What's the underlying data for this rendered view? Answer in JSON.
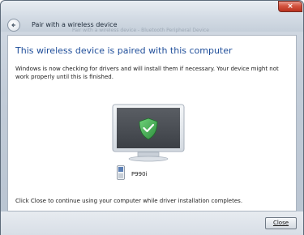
{
  "window": {
    "title": "Pair with a wireless device",
    "ghost_title": "Pair with a wireless device - Bluetooth Peripheral Device",
    "close_glyph": "×"
  },
  "main": {
    "heading": "This wireless device is paired with this computer",
    "description": "Windows is now checking for drivers and will install them if necessary. Your device might not work properly until this is finished.",
    "device_name": "P990i",
    "footer": "Click Close to continue using your computer while driver installation completes."
  },
  "buttons": {
    "close_label": "Close"
  },
  "icons": {
    "back": "back-arrow-icon",
    "monitor": "monitor-icon",
    "shield": "shield-check-icon",
    "phone": "phone-icon"
  },
  "colors": {
    "heading": "#1f4e9a",
    "shield": "#3aa84a",
    "close_btn": "#c8422c"
  }
}
